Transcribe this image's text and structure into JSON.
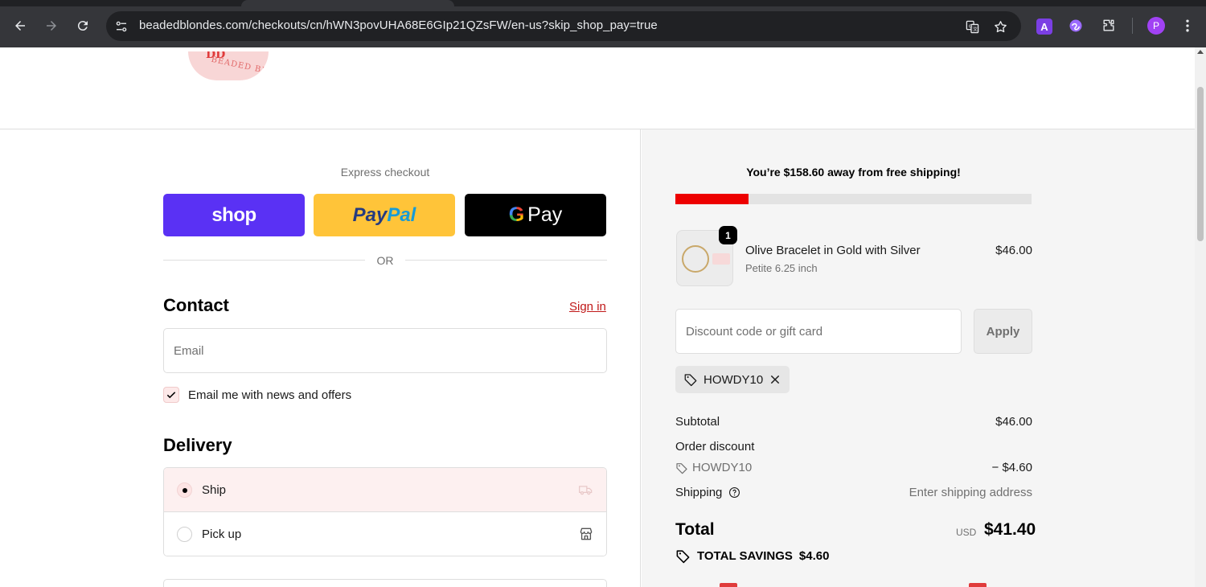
{
  "browser": {
    "url": "beadedblondes.com/checkouts/cn/hWN3povUHA68E6GIp21QZsFW/en-us?skip_shop_pay=true",
    "profile_initial": "P",
    "extension_a_label": "A"
  },
  "express": {
    "label": "Express checkout",
    "shop_label": "shop",
    "paypal_part1": "Pay",
    "paypal_part2": "Pal",
    "gpay_g": "G",
    "gpay_label": "Pay",
    "or_text": "OR"
  },
  "contact": {
    "title": "Contact",
    "signin_label": "Sign in",
    "email_placeholder": "Email",
    "newsletter_label": "Email me with news and offers",
    "newsletter_checked": true
  },
  "delivery": {
    "title": "Delivery",
    "options": [
      {
        "label": "Ship",
        "selected": true,
        "icon": "truck-icon"
      },
      {
        "label": "Pick up",
        "selected": false,
        "icon": "store-icon"
      }
    ]
  },
  "summary": {
    "free_shipping_text": "You’re $158.60 away from free shipping!",
    "free_shipping_progress": 0.205,
    "progress_color": "#ed0000",
    "item": {
      "quantity": "1",
      "name": "Olive Bracelet in Gold with Silver",
      "variant": "Petite 6.25 inch",
      "price": "$46.00"
    },
    "discount_placeholder": "Discount code or gift card",
    "apply_label": "Apply",
    "applied_code": "HOWDY10",
    "subtotal_label": "Subtotal",
    "subtotal_value": "$46.00",
    "order_discount_label": "Order discount",
    "discount_code": "HOWDY10",
    "discount_value": "− $4.60",
    "shipping_label": "Shipping",
    "shipping_value": "Enter shipping address",
    "total_label": "Total",
    "currency": "USD",
    "total_value": "$41.40",
    "savings_label": "TOTAL SAVINGS",
    "savings_value": "$4.60"
  }
}
